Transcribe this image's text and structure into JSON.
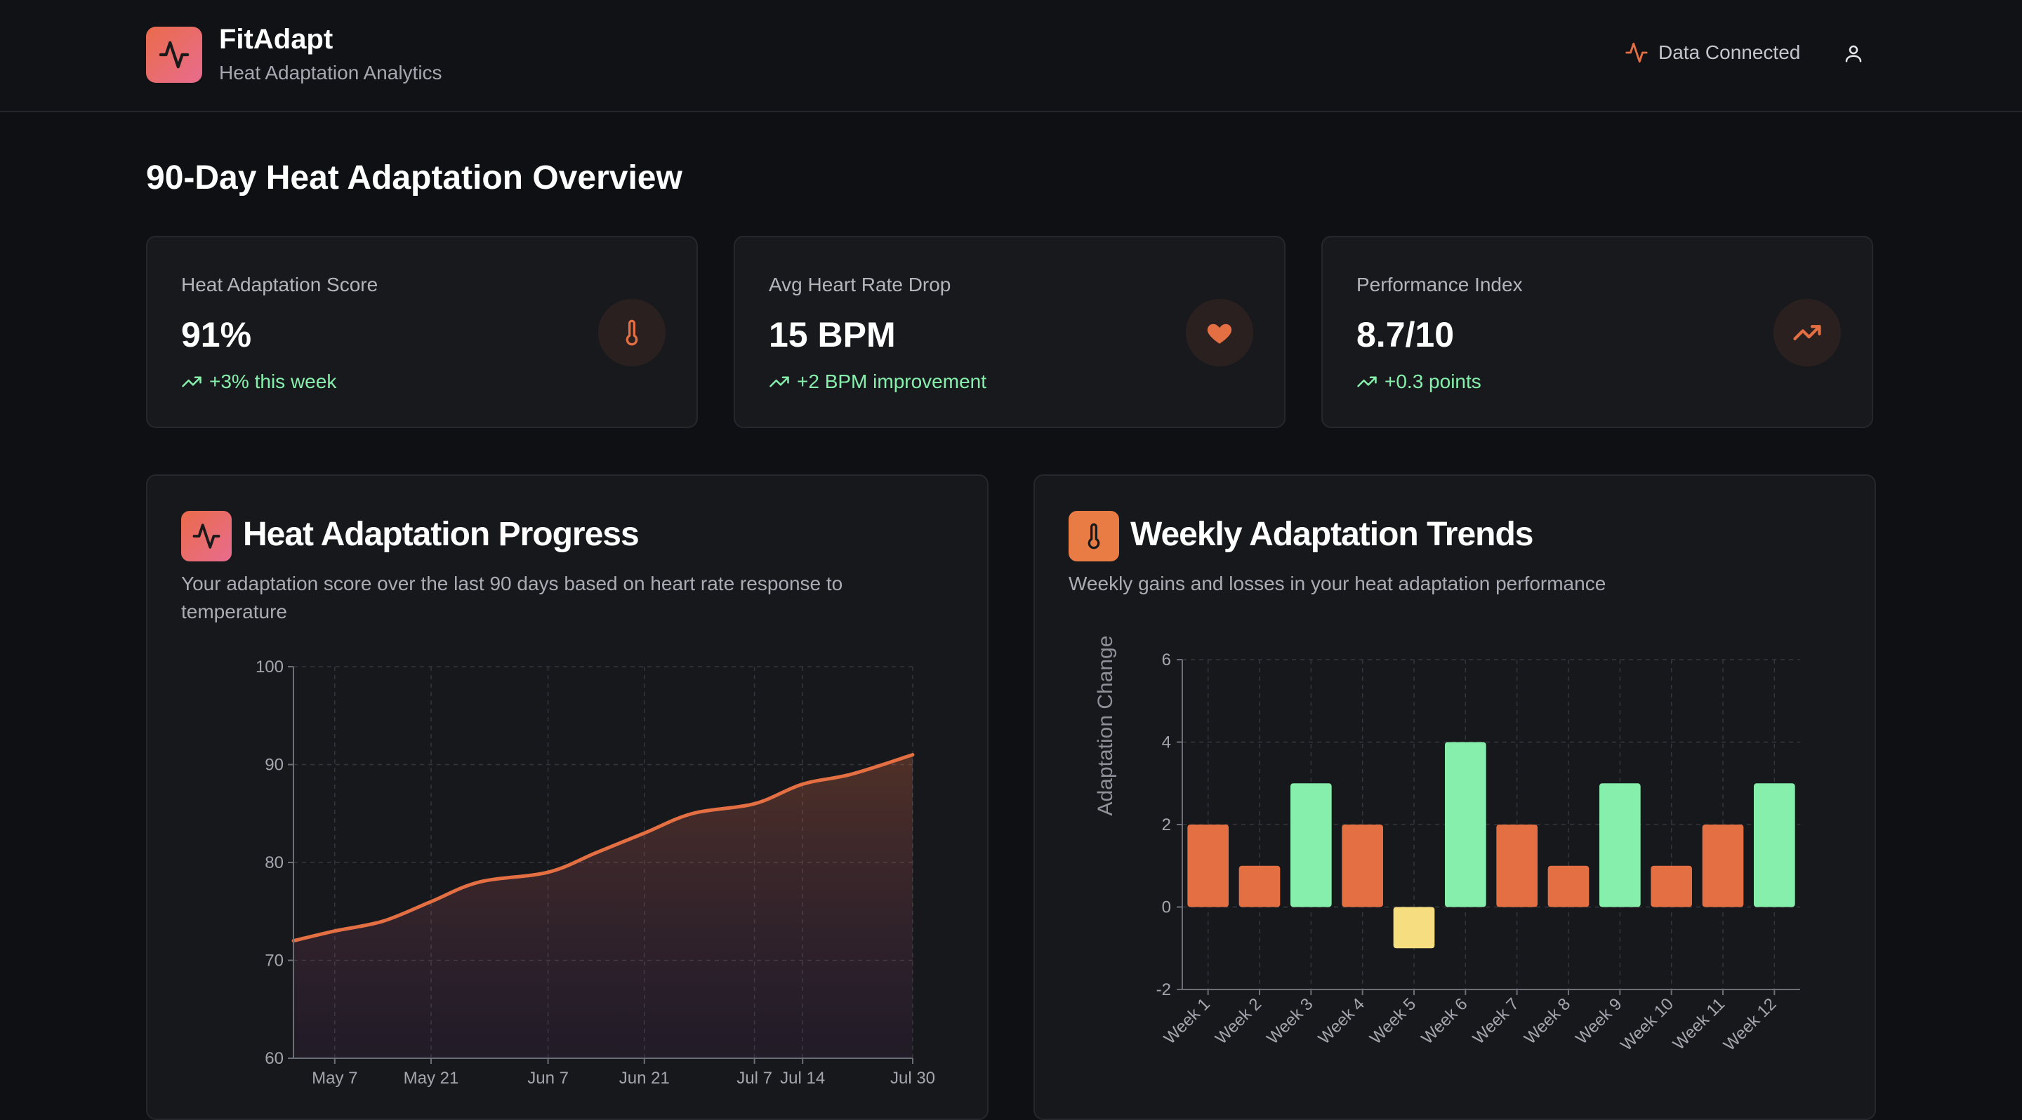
{
  "header": {
    "app_name": "FitAdapt",
    "app_subtitle": "Heat Adaptation Analytics",
    "connection_status": "Data Connected",
    "icons": {
      "logo": "activity-icon",
      "status": "activity-icon",
      "account": "user-icon"
    }
  },
  "page_title": "90-Day Heat Adaptation Overview",
  "stats": [
    {
      "label": "Heat Adaptation Score",
      "value": "91%",
      "change": "+3% this week",
      "icon": "thermometer-icon"
    },
    {
      "label": "Avg Heart Rate Drop",
      "value": "15 BPM",
      "change": "+2 BPM improvement",
      "icon": "heart-icon"
    },
    {
      "label": "Performance Index",
      "value": "8.7/10",
      "change": "+0.3 points",
      "icon": "trending-up-icon"
    }
  ],
  "colors": {
    "accent": "#e46f43",
    "positive": "#86efac",
    "neutral": "#f6dd80",
    "logo_gradient": [
      "#ea6b4a",
      "#e86c8e"
    ]
  },
  "panels": {
    "progress": {
      "title": "Heat Adaptation Progress",
      "description": "Your adaptation score over the last 90 days based on heart rate response to temperature"
    },
    "weekly": {
      "title": "Weekly Adaptation Trends",
      "description": "Weekly gains and losses in your heat adaptation performance"
    }
  },
  "chart_data": [
    {
      "type": "area",
      "title": "",
      "xlabel": "",
      "ylabel": "",
      "ylim": [
        60,
        100
      ],
      "yticks": [
        60,
        70,
        80,
        90,
        100
      ],
      "xlim": [
        "2024-05-01",
        "2024-07-30"
      ],
      "xticks": [
        "May 7",
        "May 21",
        "Jun 7",
        "Jun 21",
        "Jul 7",
        "Jul 14",
        "Jul 30"
      ],
      "xtick_dates": [
        "2024-05-07",
        "2024-05-21",
        "2024-06-07",
        "2024-06-21",
        "2024-07-07",
        "2024-07-14",
        "2024-07-30"
      ],
      "grid": true,
      "x": [
        "2024-05-01",
        "2024-05-07",
        "2024-05-14",
        "2024-05-21",
        "2024-05-28",
        "2024-06-07",
        "2024-06-14",
        "2024-06-21",
        "2024-06-28",
        "2024-07-07",
        "2024-07-14",
        "2024-07-21",
        "2024-07-30"
      ],
      "values": [
        72,
        73,
        74,
        76,
        78,
        79,
        81,
        83,
        85,
        86,
        88,
        89,
        91
      ]
    },
    {
      "type": "bar",
      "title": "",
      "xlabel": "",
      "ylabel": "Adaptation Change",
      "ylim": [
        -2,
        6
      ],
      "yticks": [
        -2,
        0,
        2,
        4,
        6
      ],
      "grid": true,
      "categories": [
        "Week 1",
        "Week 2",
        "Week 3",
        "Week 4",
        "Week 5",
        "Week 6",
        "Week 7",
        "Week 8",
        "Week 9",
        "Week 10",
        "Week 11",
        "Week 12"
      ],
      "values": [
        2,
        1,
        3,
        2,
        -1,
        4,
        2,
        1,
        3,
        1,
        2,
        3
      ],
      "bar_colors": [
        "#e46f43",
        "#e46f43",
        "#86efac",
        "#e46f43",
        "#f6dd80",
        "#86efac",
        "#e46f43",
        "#e46f43",
        "#86efac",
        "#e46f43",
        "#e46f43",
        "#86efac"
      ]
    }
  ]
}
